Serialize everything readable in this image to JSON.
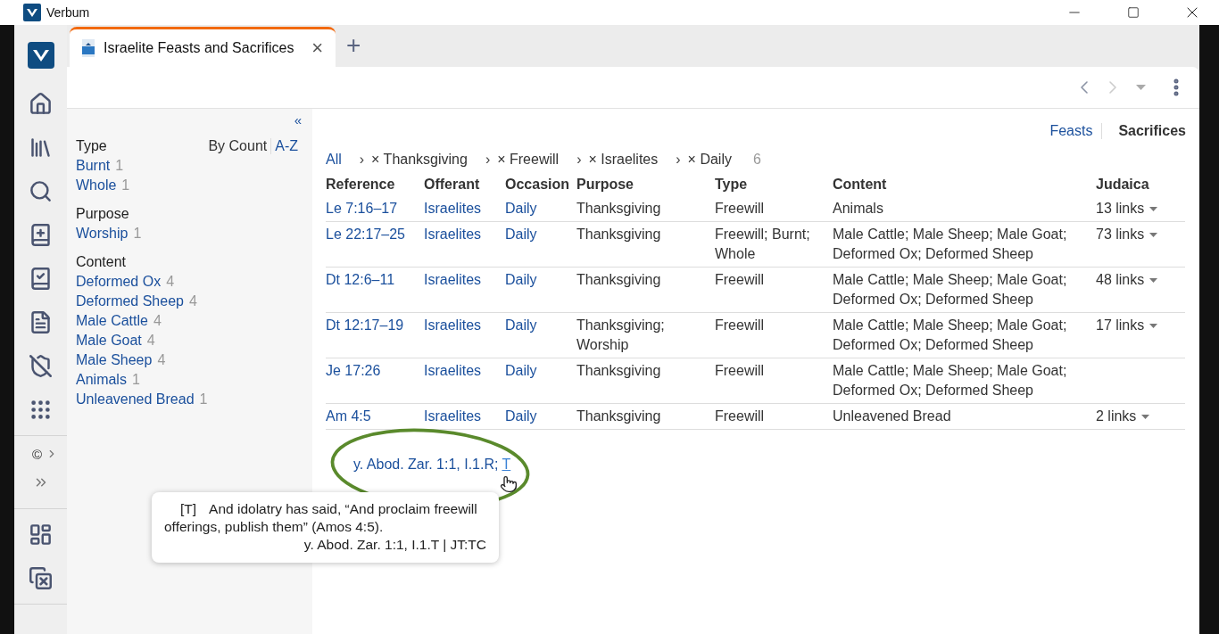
{
  "window": {
    "title": "Verbum"
  },
  "tabs": [
    {
      "label": "Israelite Feasts and Sacrifices",
      "selected": true,
      "close": "×"
    }
  ],
  "new_tab": "+",
  "rail": {
    "copyright": "©"
  },
  "facets": {
    "collapse": "«",
    "sort": [
      {
        "label": "By Count",
        "selected": true
      },
      {
        "label": "A-Z",
        "selected": false
      }
    ],
    "groups": [
      {
        "title": "Type",
        "items": [
          {
            "label": "Burnt",
            "count": "1"
          },
          {
            "label": "Whole",
            "count": "1"
          }
        ]
      },
      {
        "title": "Purpose",
        "items": [
          {
            "label": "Worship",
            "count": "1"
          }
        ]
      },
      {
        "title": "Content",
        "items": [
          {
            "label": "Deformed Ox",
            "count": "4"
          },
          {
            "label": "Deformed Sheep",
            "count": "4"
          },
          {
            "label": "Male Cattle",
            "count": "4"
          },
          {
            "label": "Male Goat",
            "count": "4"
          },
          {
            "label": "Male Sheep",
            "count": "4"
          },
          {
            "label": "Animals",
            "count": "1"
          },
          {
            "label": "Unleavened Bread",
            "count": "1"
          }
        ]
      }
    ]
  },
  "views": [
    {
      "label": "Feasts",
      "selected": false
    },
    {
      "label": "Sacrifices",
      "selected": true
    }
  ],
  "breadcrumb": {
    "root": "All",
    "filters": [
      {
        "separator": "›",
        "label": "× Thanksgiving"
      },
      {
        "separator": "›",
        "label": "× Freewill"
      },
      {
        "separator": "›",
        "label": "× Israelites"
      },
      {
        "separator": "›",
        "label": "× Daily"
      }
    ],
    "count": "6"
  },
  "table": {
    "columns": [
      "Reference",
      "Offerant",
      "Occasion",
      "Purpose",
      "Type",
      "Content",
      "Judaica"
    ],
    "rows": [
      {
        "reference": "Le 7:16–17",
        "offerant": "Israelites",
        "occasion": "Daily",
        "purpose": "Thanksgiving",
        "type": "Freewill",
        "content": "Animals",
        "judaica": "13 links"
      },
      {
        "reference": "Le 22:17–25",
        "offerant": "Israelites",
        "occasion": "Daily",
        "purpose": "Thanksgiving",
        "type": "Freewill; Burnt; Whole",
        "content": "Male Cattle; Male Sheep; Male Goat; Deformed Ox; Deformed Sheep",
        "judaica": "73 links"
      },
      {
        "reference": "Dt 12:6–11",
        "offerant": "Israelites",
        "occasion": "Daily",
        "purpose": "Thanksgiving",
        "type": "Freewill",
        "content": "Male Cattle; Male Sheep; Male Goat; Deformed Ox; Deformed Sheep",
        "judaica": "48 links"
      },
      {
        "reference": "Dt 12:17–19",
        "offerant": "Israelites",
        "occasion": "Daily",
        "purpose": "Thanksgiving; Worship",
        "type": "Freewill",
        "content": "Male Cattle; Male Sheep; Male Goat; Deformed Ox; Deformed Sheep",
        "judaica": "17 links"
      },
      {
        "reference": "Je 17:26",
        "offerant": "Israelites",
        "occasion": "Daily",
        "purpose": "Thanksgiving",
        "type": "Freewill",
        "content": "Male Cattle; Male Sheep; Male Goat; Deformed Ox; Deformed Sheep"
      },
      {
        "reference": "Am 4:5",
        "offerant": "Israelites",
        "occasion": "Daily",
        "purpose": "Thanksgiving",
        "type": "Freewill",
        "content": "Unleavened Bread",
        "judaica": "2 links"
      }
    ]
  },
  "citations": [
    {
      "label": "y. Abod. Zar. 1:1, I.1.R;",
      "hovered": false
    },
    {
      "label": "T",
      "hovered": true
    }
  ],
  "tooltip": {
    "marker": "[T]",
    "text": "And idolatry has said, “And proclaim freewill offerings, publish them” (Amos 4:5).",
    "source": "y. Abod. Zar. 1:1, I.1.T | JT:TC"
  }
}
